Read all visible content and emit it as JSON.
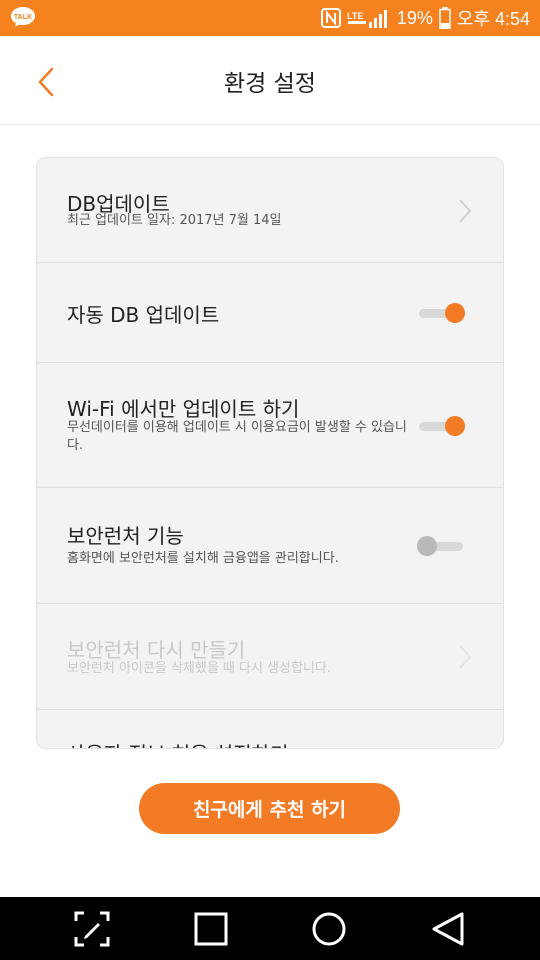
{
  "status_bar": {
    "battery_percent": "19%",
    "time": "오후 4:54",
    "icons": [
      "kakaotalk-icon",
      "nfc-icon",
      "signal-icon",
      "battery-icon"
    ]
  },
  "header": {
    "title": "환경 설정",
    "back_icon": "chevron-left-icon"
  },
  "settings": {
    "db_update": {
      "title": "DB업데이트",
      "subtitle": "최근 업데이트 일자: 2017년 7월 14일"
    },
    "auto_db_update": {
      "title": "자동 DB 업데이트",
      "enabled": true
    },
    "wifi_only": {
      "title": "Wi-Fi 에서만 업데이트 하기",
      "subtitle": "무선데이터를 이용해 업데이트 시 이용요금이 발생할 수 있습니다.",
      "enabled": true
    },
    "security_launcher": {
      "title": "보안런처 기능",
      "subtitle": "홈화면에 보안런처를 설치해 금융앱을 관리합니다.",
      "enabled": false
    },
    "recreate_launcher": {
      "title": "보안런처 다시 만들기",
      "subtitle": "보안런처 아이콘을 삭제했을 때 다시 생성합니다.",
      "disabled": true
    },
    "permissions_partial": {
      "title": "사용자 정보 허용 설정하기"
    }
  },
  "recommend_button": {
    "label": "친구에게 추천 하기"
  },
  "nav_bar": {
    "icons": [
      "screenshot-edit-icon",
      "recent-apps-icon",
      "home-icon",
      "back-icon"
    ]
  },
  "colors": {
    "accent": "#f47b26",
    "status_bar": "#f5811f"
  }
}
